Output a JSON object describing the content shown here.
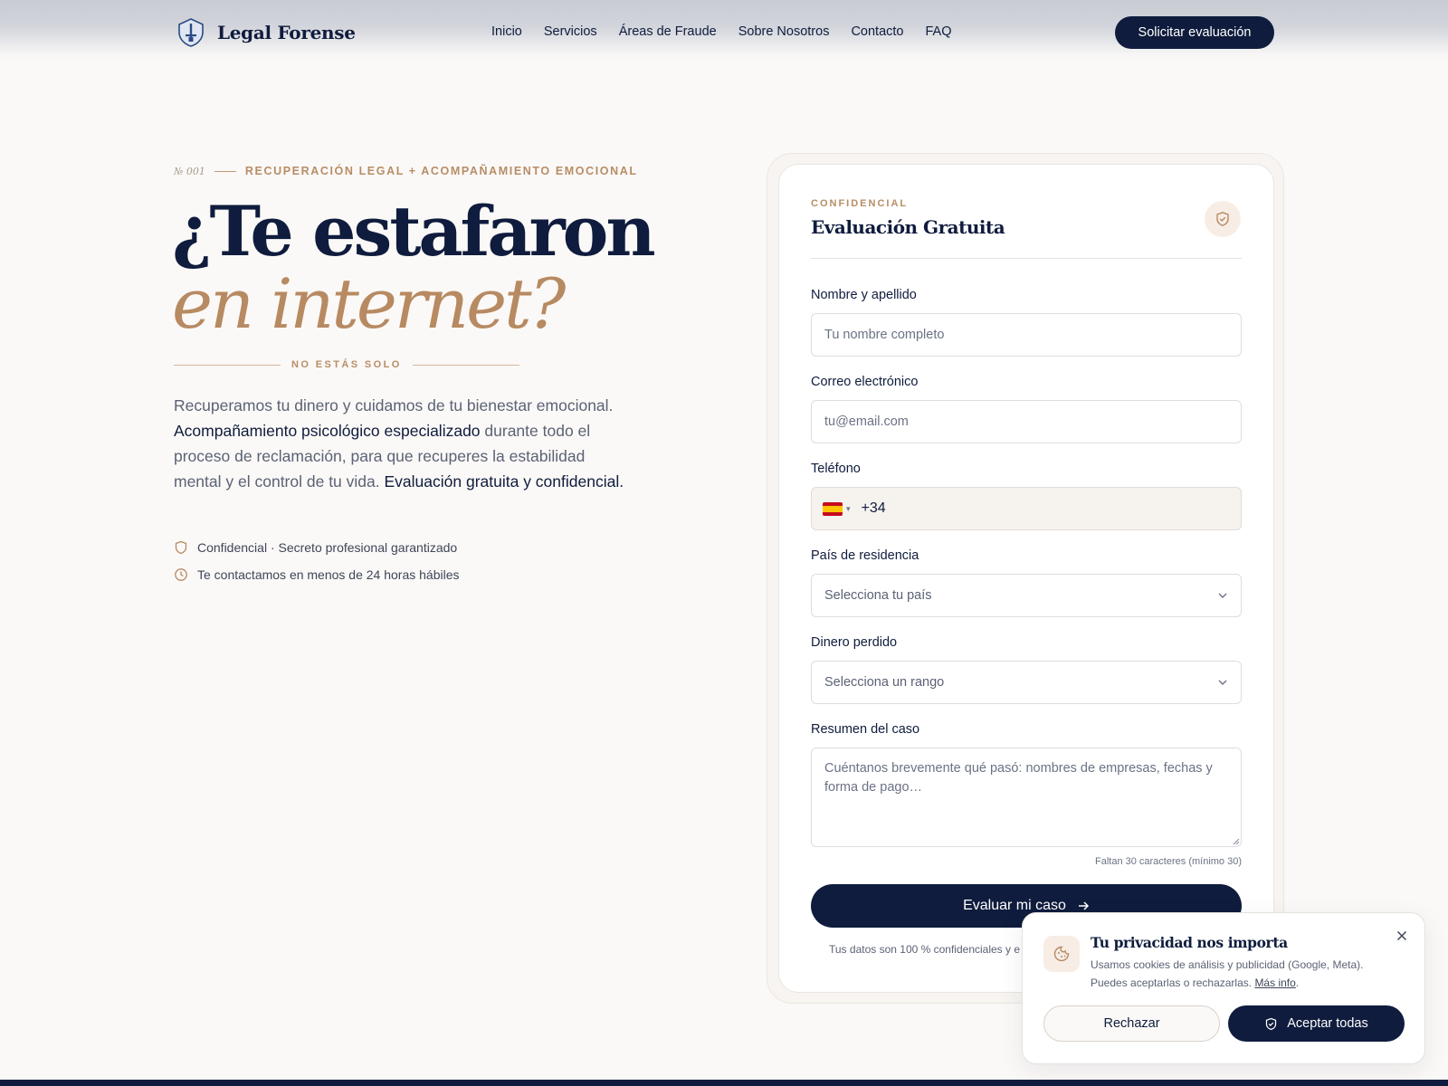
{
  "brand": {
    "name": "Legal Forense"
  },
  "nav": {
    "items": [
      "Inicio",
      "Servicios",
      "Áreas de Fraude",
      "Sobre Nosotros",
      "Contacto",
      "FAQ"
    ],
    "cta": "Solicitar evaluación"
  },
  "hero": {
    "number": "№ 001",
    "eyebrow": "RECUPERACIÓN LEGAL + ACOMPAÑAMIENTO EMOCIONAL",
    "title_line1": "¿Te estafaron",
    "title_line2": "en internet?",
    "divider": "NO ESTÁS SOLO",
    "lead": {
      "p1": "Recuperamos tu dinero y cuidamos de tu bienestar emocional. ",
      "b1": "Acompañamiento psicológico especializado",
      "p2": " durante todo el proceso de reclamación, para que recuperes la estabilidad mental y el control de tu vida. ",
      "b2": "Evaluación gratuita y confidencial."
    },
    "checks": [
      "Confidencial · Secreto profesional garantizado",
      "Te contactamos en menos de 24 horas hábiles"
    ]
  },
  "form": {
    "eyebrow": "CONFIDENCIAL",
    "title": "Evaluación Gratuita",
    "name": {
      "label": "Nombre y apellido",
      "placeholder": "Tu nombre completo"
    },
    "email": {
      "label": "Correo electrónico",
      "placeholder": "tu@email.com"
    },
    "phone": {
      "label": "Teléfono",
      "dial_code": "+34",
      "flag_icon": "spain-flag-icon"
    },
    "country": {
      "label": "País de residencia",
      "placeholder": "Selecciona tu país"
    },
    "money": {
      "label": "Dinero perdido",
      "placeholder": "Selecciona un rango"
    },
    "summary": {
      "label": "Resumen del caso",
      "placeholder": "Cuéntanos brevemente qué pasó: nombres de empresas, fechas y forma de pago…"
    },
    "counter": "Faltan 30 caracteres (mínimo 30)",
    "submit": "Evaluar mi caso",
    "note": "Tus datos son 100 % confidenciales y e"
  },
  "cookie": {
    "title": "Tu privacidad nos importa",
    "text": "Usamos cookies de análisis y publicidad (Google, Meta). Puedes aceptarlas o rechazarlas. ",
    "link": "Más info",
    "link_suffix": ".",
    "reject": "Rechazar",
    "accept": "Aceptar todas"
  },
  "colors": {
    "navy": "#0f1c3d",
    "gold": "#b78a62",
    "background": "#fbf9f7"
  }
}
